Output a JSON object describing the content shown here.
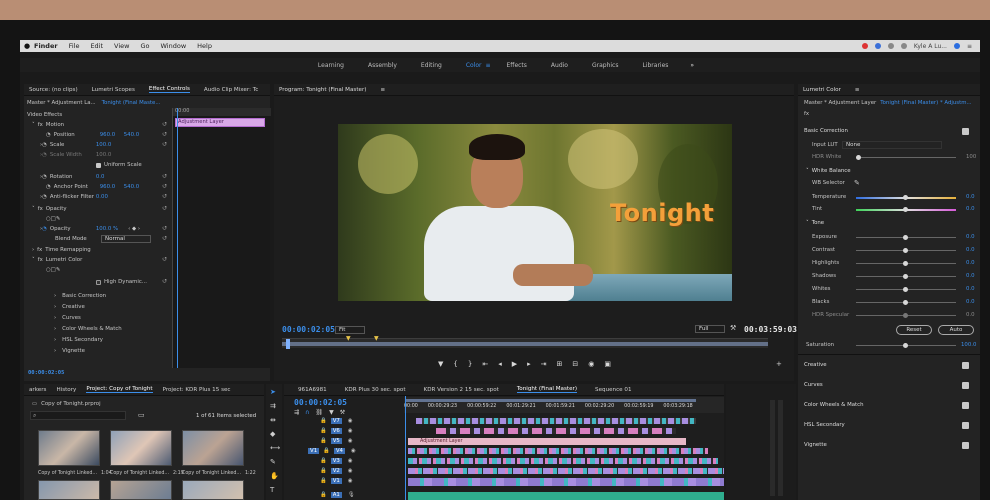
{
  "menubar": {
    "apple": "",
    "items": [
      "Finder",
      "File",
      "Edit",
      "View",
      "Go",
      "Window",
      "Help"
    ],
    "right_text": "Kyle A Lu..."
  },
  "workspaces": {
    "tabs": [
      "Learning",
      "Assembly",
      "Editing",
      "Color",
      "Effects",
      "Audio",
      "Graphics",
      "Libraries"
    ],
    "active": "Color",
    "more": "»"
  },
  "source_panel": {
    "tabs": [
      "Source: (no clips)",
      "Lumetri Scopes",
      "Effect Controls",
      "Audio Clip Mixer: Tc"
    ],
    "master_label": "Master * Adjustment La...",
    "master_clip": "Tonight (Final Maste...",
    "clip_label": "Adjustment Layer",
    "section_video": "Video Effects",
    "motion": "Motion",
    "position_label": "Position",
    "position_x": "960.0",
    "position_y": "540.0",
    "scale_label": "Scale",
    "scale_value": "100.0",
    "scale_width_label": "Scale Width",
    "scale_width_value": "100.0",
    "uniform_scale": "Uniform Scale",
    "rotation_label": "Rotation",
    "rotation_value": "0.0",
    "anchor_label": "Anchor Point",
    "anchor_x": "960.0",
    "anchor_y": "540.0",
    "antiflicker_label": "Anti-flicker Filter",
    "antiflicker_value": "0.00",
    "opacity": "Opacity",
    "opacity_label": "Opacity",
    "opacity_value": "100.0 %",
    "blend_label": "Blend Mode",
    "blend_value": "Normal",
    "time_remap": "Time Remapping",
    "lumetri": "Lumetri Color",
    "high_dynamic": "High Dynamic...",
    "sub_items": [
      "Basic Correction",
      "Creative",
      "Curves",
      "Color Wheels & Match",
      "HSL Secondary",
      "Vignette"
    ],
    "timecode": "00:00:02:05",
    "mini_ruler": "00:00"
  },
  "program": {
    "title": "Program: Tonight (Final Master)",
    "overlay_title": "Tonight",
    "timecode": "00:00:02:05",
    "fit": "Fit",
    "quality": "Full",
    "duration": "00:03:59:03"
  },
  "lumetri_panel": {
    "title": "Lumetri Color",
    "master_label": "Master * Adjustment Layer",
    "master_clip": "Tonight (Final Master) * Adjustm...",
    "basic": "Basic Correction",
    "input_lut_label": "Input LUT",
    "input_lut_value": "None",
    "hdr_white_label": "HDR White",
    "hdr_white_value": "100",
    "white_balance": "White Balance",
    "wb_selector": "WB Selector",
    "temperature_label": "Temperature",
    "temperature_value": "0.0",
    "tint_label": "Tint",
    "tint_value": "0.0",
    "tone": "Tone",
    "tone_rows": [
      {
        "label": "Exposure",
        "value": "0.0"
      },
      {
        "label": "Contrast",
        "value": "0.0"
      },
      {
        "label": "Highlights",
        "value": "0.0"
      },
      {
        "label": "Shadows",
        "value": "0.0"
      },
      {
        "label": "Whites",
        "value": "0.0"
      },
      {
        "label": "Blacks",
        "value": "0.0"
      }
    ],
    "hdr_specular_label": "HDR Specular",
    "hdr_specular_value": "0.0",
    "reset": "Reset",
    "auto": "Auto",
    "saturation_label": "Saturation",
    "saturation_value": "100.0",
    "sections": [
      "Creative",
      "Curves",
      "Color Wheels & Match",
      "HSL Secondary",
      "Vignette"
    ]
  },
  "project_panel": {
    "tabs": [
      "arkers",
      "History",
      "Project: Copy of Tonight",
      "Project: KDR Plus 15 sec"
    ],
    "file": "Copy of Tonight.prproj",
    "count": "1 of 61 Items selected",
    "items": [
      {
        "name": "Copy of Tonight Linked...",
        "dur": "1:04"
      },
      {
        "name": "Copy of Tonight Linked...",
        "dur": "2:19"
      },
      {
        "name": "Copy of Tonight Linked...",
        "dur": "1:22"
      }
    ]
  },
  "timeline": {
    "tabs": [
      "961A6981",
      "KDR Plus 30 sec. spot",
      "KDR Version 2 15 sec. spot",
      "Tonight (Final Master)",
      "Sequence 01"
    ],
    "timecode": "00:00:02:05",
    "ruler": [
      "00:00",
      "00:00:29:23",
      "00:00:59:22",
      "00:01:29:21",
      "00:01:59:21",
      "00:02:29:20",
      "00:02:59:19",
      "00:03:29:18",
      "00:03:59:18",
      "00"
    ],
    "tracks": [
      "V7",
      "V6",
      "V5",
      "V4",
      "V3",
      "V2",
      "V1"
    ],
    "v1_src": "V1",
    "audio_track": "A1",
    "adjustment_clip": "Adjustment Layer"
  },
  "colors": {
    "accent": "#3b8eea",
    "title": "#f4a03a",
    "clip_purple": "#a88ee0",
    "clip_cyan": "#43b7c3",
    "clip_pink": "#d77fbf"
  }
}
